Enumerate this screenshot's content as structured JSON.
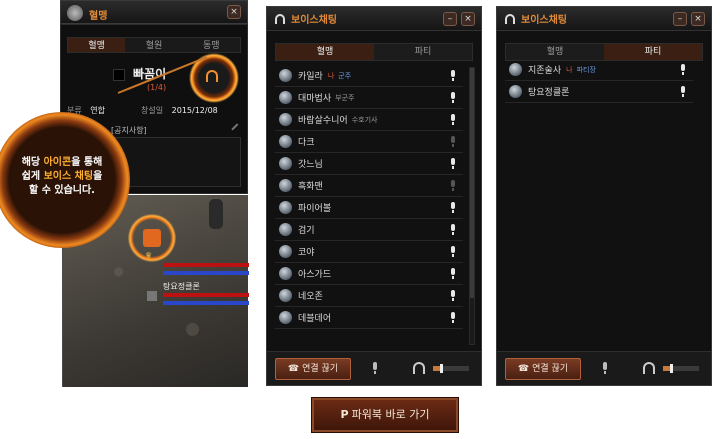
{
  "guild_panel": {
    "title": "혈맹",
    "tabs": [
      "혈맹",
      "혈원",
      "동맹"
    ],
    "guild_name": "빠꼼이",
    "member_count": "(1/4)",
    "info_label": "분류",
    "info_value": "연합",
    "founded_label": "창설일",
    "founded_date": "2015/12/08",
    "notice_label": "[공지사항]"
  },
  "callout": {
    "line1_pre": "해당 ",
    "line1_hl": "아이콘",
    "line1_post": "을 통해",
    "line2_pre": "쉽게 ",
    "line2_hl": "보이스 채팅",
    "line2_post": "을",
    "line3": "할 수 있습니다."
  },
  "game_scene": {
    "member_label": "탕요정클론"
  },
  "voice_panel_guild": {
    "title": "보이스채팅",
    "tabs": [
      "혈맹",
      "파티"
    ],
    "members": [
      {
        "name": "카일라",
        "me": "나",
        "role": "군주",
        "role_color": "blue",
        "mic": true
      },
      {
        "name": "대마법사",
        "me": "",
        "role": "부군주",
        "role_color": "gray",
        "mic": true
      },
      {
        "name": "바람살수니어",
        "me": "",
        "role": "수호기사",
        "role_color": "gray",
        "mic": true
      },
      {
        "name": "다크",
        "me": "",
        "role": "",
        "role_color": "gray",
        "mic": false
      },
      {
        "name": "갓느님",
        "me": "",
        "role": "",
        "role_color": "gray",
        "mic": true
      },
      {
        "name": "흑화맨",
        "me": "",
        "role": "",
        "role_color": "gray",
        "mic": false
      },
      {
        "name": "파이어볼",
        "me": "",
        "role": "",
        "role_color": "gray",
        "mic": true
      },
      {
        "name": "검기",
        "me": "",
        "role": "",
        "role_color": "gray",
        "mic": true
      },
      {
        "name": "코야",
        "me": "",
        "role": "",
        "role_color": "gray",
        "mic": true
      },
      {
        "name": "아스가드",
        "me": "",
        "role": "",
        "role_color": "gray",
        "mic": true
      },
      {
        "name": "네오존",
        "me": "",
        "role": "",
        "role_color": "gray",
        "mic": true
      },
      {
        "name": "데블데어",
        "me": "",
        "role": "",
        "role_color": "gray",
        "mic": true
      }
    ],
    "disconnect_label": "연결 끊기",
    "volume": 0.2
  },
  "voice_panel_party": {
    "title": "보이스채팅",
    "tabs": [
      "혈맹",
      "파티"
    ],
    "members": [
      {
        "name": "지존술사",
        "me": "나",
        "role": "파티장",
        "mic": true
      },
      {
        "name": "탕요정클론",
        "me": "",
        "role": "",
        "mic": true
      }
    ],
    "disconnect_label": "연결 끊기",
    "volume": 0.2
  },
  "footer": {
    "button_label": "파워북 바로 가기",
    "button_icon": "P"
  },
  "colors": {
    "accent": "#e08a3a",
    "tab_active": "#3a1f12",
    "me_tag": "#e05a3a",
    "role_blue": "#6a9ae0"
  }
}
